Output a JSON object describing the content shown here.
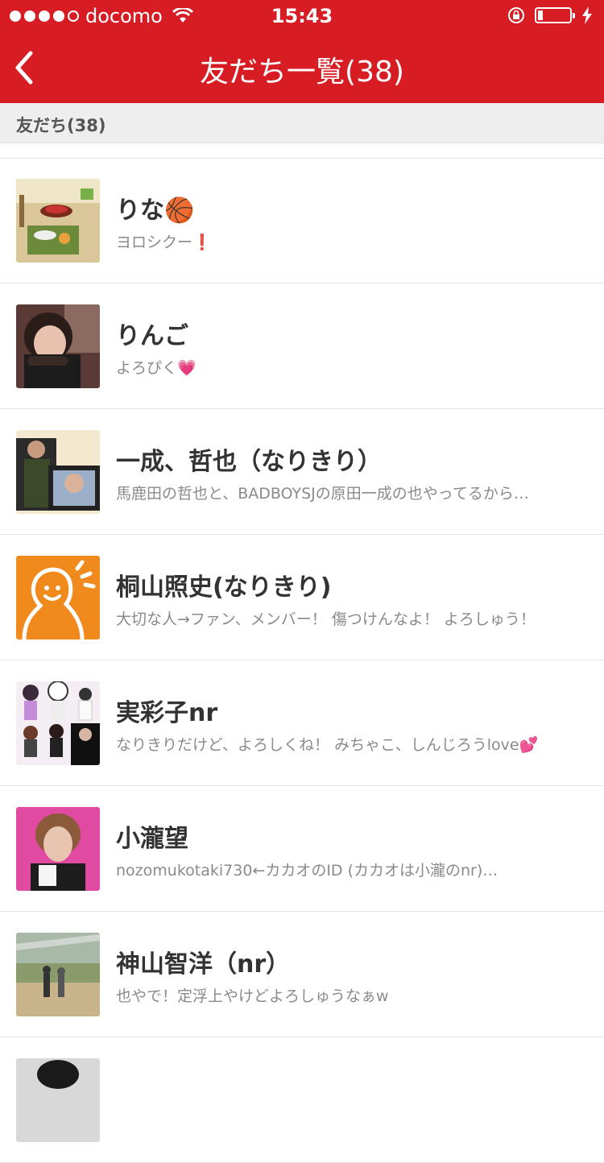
{
  "status_bar": {
    "carrier": "docomo",
    "time": "15:43",
    "signal_bars_filled": 4,
    "signal_bars_total": 5,
    "battery_level": 0.15
  },
  "nav": {
    "title": "友だち一覧(38)",
    "back_icon": "chevron-left-icon"
  },
  "section": {
    "label": "友だち(38)"
  },
  "friends": [
    {
      "name": "りな🏀",
      "status": "ヨロシクー❗",
      "avatar": "game-room-avatar"
    },
    {
      "name": "りんご",
      "status": "よろぴく💗",
      "avatar": "girl-photo-avatar"
    },
    {
      "name": "一成、哲也（なりきり）",
      "status": "馬鹿田の哲也と、BADBOYSJの原田一成の也やってるから…",
      "avatar": "film-strip-avatar"
    },
    {
      "name": "桐山照史(なりきり)",
      "status": "大切な人→ファン、メンバー！ 傷つけんなよ！ よろしゅう！",
      "avatar": "default-orange-avatar"
    },
    {
      "name": "実彩子nr",
      "status": "なりきりだけど、よろしくね！ みちゃこ、しんじろうlove💕",
      "avatar": "collage-avatar"
    },
    {
      "name": "小瀧望",
      "status": "nozomukotaki730←カカオのID  (カカオは小瀧のnr)…",
      "avatar": "pink-portrait-avatar"
    },
    {
      "name": "神山智洋（nr）",
      "status": "也やで！定浮上やけどよろしゅうなぁw",
      "avatar": "park-photo-avatar"
    },
    {
      "name": "",
      "status": "",
      "avatar": "partial-avatar"
    }
  ],
  "colors": {
    "brand_red": "#d71d23",
    "section_bg": "#eeeeee",
    "default_avatar_orange": "#f08a1d"
  }
}
